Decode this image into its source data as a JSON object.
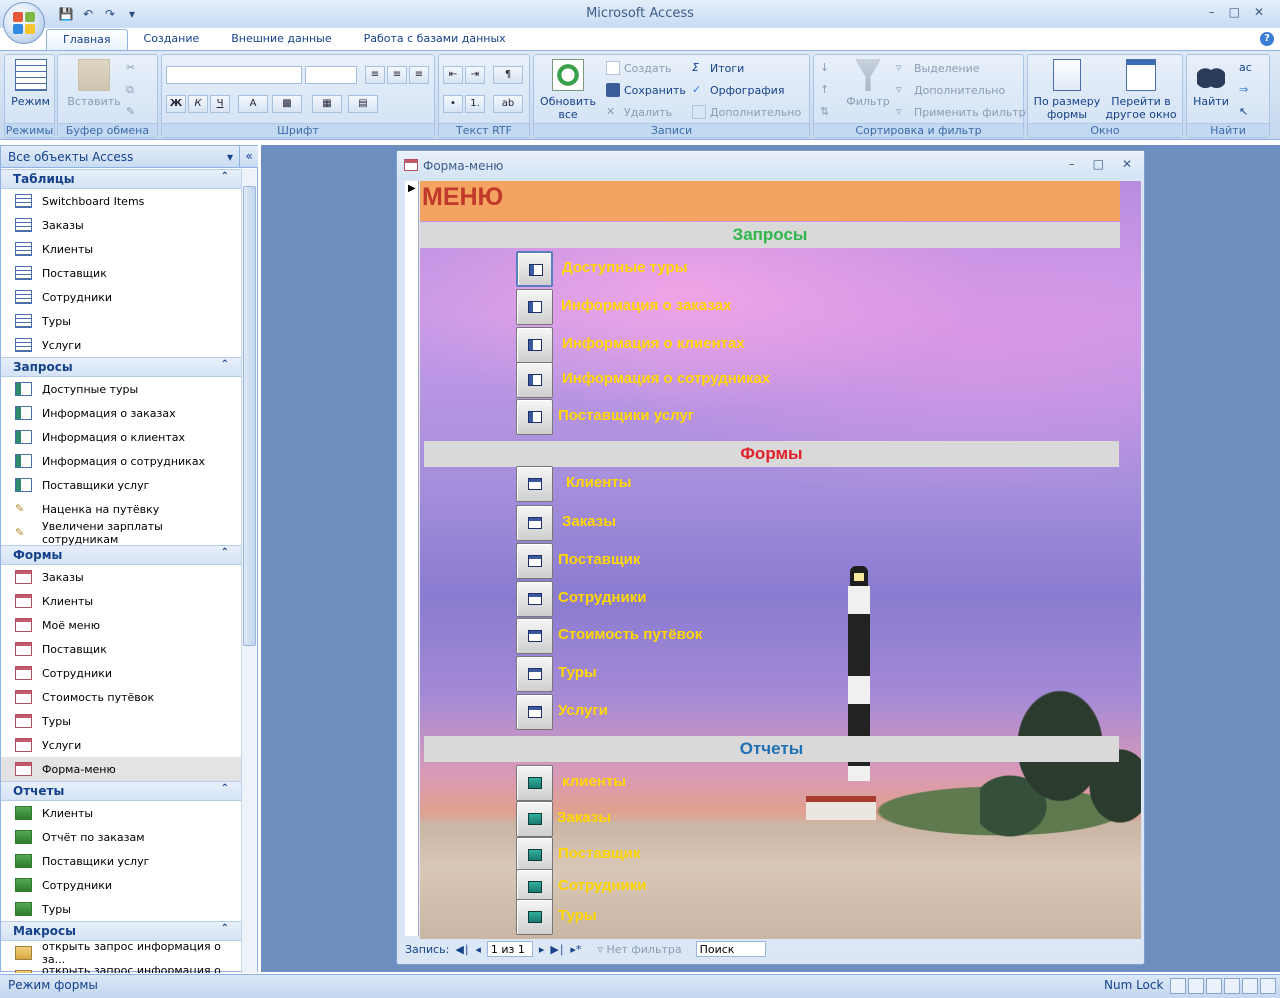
{
  "app": {
    "title": "Microsoft Access"
  },
  "tabs": [
    "Главная",
    "Создание",
    "Внешние данные",
    "Работа с базами данных"
  ],
  "ribbon": {
    "groups": {
      "views": "Режимы",
      "clipboard": "Буфер обмена",
      "font": "Шрифт",
      "rtf": "Текст RTF",
      "records": "Записи",
      "sort": "Сортировка и фильтр",
      "window": "Окно",
      "find": "Найти"
    },
    "views": {
      "mode": "Режим"
    },
    "clipboard": {
      "paste": "Вставить"
    },
    "records": {
      "refresh": "Обновить",
      "refresh2": "все",
      "create": "Создать",
      "save": "Сохранить",
      "delete": "Удалить",
      "totals": "Итоги",
      "spelling": "Орфография",
      "more": "Дополнительно"
    },
    "sort": {
      "filter": "Фильтр",
      "selection": "Выделение",
      "advanced": "Дополнительно",
      "apply": "Применить фильтр"
    },
    "window": {
      "fit1": "По размеру",
      "fit2": "формы",
      "switch1": "Перейти в",
      "switch2": "другое окно"
    },
    "find": {
      "find": "Найти"
    }
  },
  "nav": {
    "header": "Все объекты Access",
    "sections": [
      {
        "title": "Таблицы",
        "icon": "table",
        "items": [
          "Switchboard Items",
          "Заказы",
          "Клиенты",
          "Поставщик",
          "Сотрудники",
          "Туры",
          "Услуги"
        ]
      },
      {
        "title": "Запросы",
        "icon": "query",
        "items": [
          "Доступные туры",
          "Информация о заказах",
          "Информация о клиентах",
          "Информация о сотрудниках",
          "Поставщики услуг",
          "Наценка на путёвку",
          "Увеличени зарплаты сотрудникам"
        ]
      },
      {
        "title": "Формы",
        "icon": "form",
        "items": [
          "Заказы",
          "Клиенты",
          "Моё меню",
          "Поставщик",
          "Сотрудники",
          "Стоимость путёвок",
          "Туры",
          "Услуги",
          "Форма-меню"
        ]
      },
      {
        "title": "Отчеты",
        "icon": "report",
        "items": [
          "Клиенты",
          "Отчёт по заказам",
          "Поставщики услуг",
          "Сотрудники",
          "Туры"
        ]
      },
      {
        "title": "Макросы",
        "icon": "macro",
        "items": [
          "открыть запрос информация о за...",
          "открыть запрос информация о к..."
        ]
      }
    ],
    "selected": "Форма-меню"
  },
  "form": {
    "window_title": "Форма-меню",
    "menu_title": "МЕНЮ",
    "queries_header": "Запросы",
    "forms_header": "Формы",
    "reports_header": "Отчеты",
    "queries": [
      "Доступные туры",
      "Информация о заказах",
      "Информация о клиентах",
      "Информация о сотрудниках",
      "Поставщики услуг"
    ],
    "forms": [
      "Клиенты",
      "Заказы",
      "Поставщик",
      "Сотрудники",
      "Стоимость путёвок",
      "Туры",
      "Услуги"
    ],
    "reports": [
      "клиенты",
      "Заказы",
      "Поставщик",
      "Сотрудники",
      "Туры"
    ],
    "colors": {
      "queries_header": "#2eb84b",
      "forms_header": "#e0202a",
      "reports_header": "#1f6fb5",
      "labels": "#ffd700",
      "menu_bar": "#f4a460"
    }
  },
  "recnav": {
    "label": "Запись:",
    "position": "1 из 1",
    "filter": "Нет фильтра",
    "search": "Поиск"
  },
  "status": {
    "mode": "Режим формы",
    "numlock": "Num Lock"
  }
}
